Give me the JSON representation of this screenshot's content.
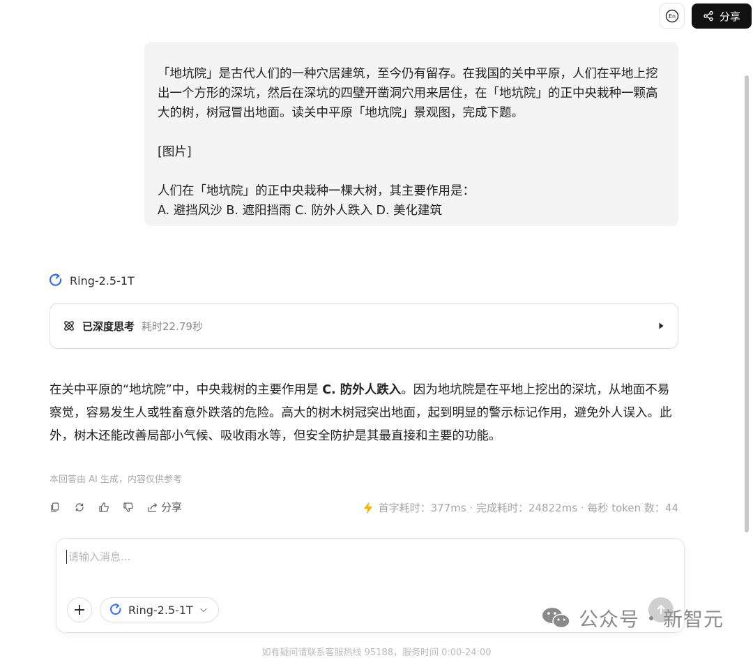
{
  "header": {
    "lang_label": "En",
    "share_label": "分享"
  },
  "user_message": {
    "paragraph_1": "「地坑院」是古代人们的一种穴居建筑，至今仍有留存。在我国的关中平原，人们在平地上挖出一个方形的深坑，然后在深坑的四壁开凿洞穴用来居住，在「地坑院」的正中央栽种一颗高大的树，树冠冒出地面。读关中平原「地坑院」景观图，完成下题。",
    "image_placeholder": "[图片]",
    "question": "人们在「地坑院」的正中央栽种一棵大树，其主要作用是：",
    "options": "A. 避挡风沙 B. 遮阳挡雨 C. 防外人跌入 D. 美化建筑"
  },
  "model": {
    "name": "Ring-2.5-1T"
  },
  "thinking": {
    "title": "已深度思考",
    "duration": "耗时22.79秒"
  },
  "answer": {
    "part_1": "在关中平原的“地坑院”中，中央栽树的主要作用是 ",
    "highlight": "C. 防外人跌入",
    "part_2": "。因为地坑院是在平地上挖出的深坑，从地面不易察觉，容易发生人或牲畜意外跌落的危险。高大的树木树冠突出地面，起到明显的警示标记作用，避免外人误入。此外，树木还能改善局部小气候、吸收雨水等，但安全防护是其最直接和主要的功能。"
  },
  "disclaimer": "本回答由 AI 生成，内容仅供参考",
  "actions": {
    "share_label": "分享"
  },
  "stats": {
    "text": "首字耗时：377ms · 完成耗时：24822ms · 每秒 token 数：44"
  },
  "composer": {
    "placeholder": "请输入消息...",
    "model_name": "Ring-2.5-1T"
  },
  "watermark": {
    "left": "公众号",
    "right": "新智元"
  },
  "footer": "如有疑问请联系客服热线 95188，服务时间 0:00-24:00",
  "colors": {
    "accent_blue": "#2f6bff",
    "bolt": "#f5b400",
    "dark_button": "#111111"
  }
}
